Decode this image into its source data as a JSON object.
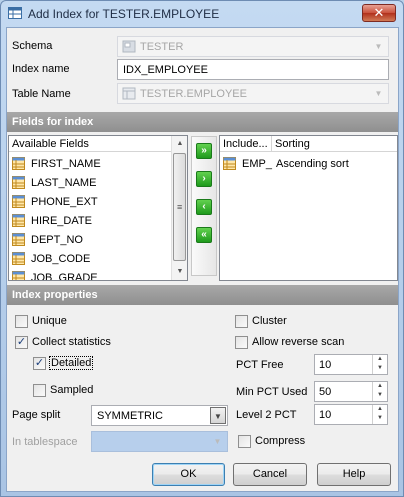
{
  "window": {
    "title": "Add Index for TESTER.EMPLOYEE",
    "close_label": "✕"
  },
  "top": {
    "schema_label": "Schema",
    "schema_value": "TESTER",
    "index_name_label": "Index name",
    "index_name_value": "IDX_EMPLOYEE",
    "table_name_label": "Table Name",
    "table_name_value": "TESTER.EMPLOYEE"
  },
  "fields_section": {
    "title": "Fields for index",
    "available_header": "Available Fields",
    "available": [
      "FIRST_NAME",
      "LAST_NAME",
      "PHONE_EXT",
      "HIRE_DATE",
      "DEPT_NO",
      "JOB_CODE",
      "JOB_GRADE"
    ],
    "included_header": "Include...",
    "sorting_header": "Sorting",
    "included": [
      {
        "name": "EMP_",
        "sorting": "Ascending sort"
      }
    ],
    "buttons": [
      "»",
      "›",
      "‹",
      "«"
    ]
  },
  "props_section": {
    "title": "Index properties",
    "unique": "Unique",
    "unique_checked": false,
    "collect_stats": "Collect statistics",
    "collect_stats_checked": true,
    "detailed": "Detailed",
    "detailed_checked": true,
    "sampled": "Sampled",
    "sampled_checked": false,
    "page_split_label": "Page split",
    "page_split_value": "SYMMETRIC",
    "in_tablespace_label": "In tablespace",
    "in_tablespace_value": "",
    "cluster": "Cluster",
    "cluster_checked": false,
    "allow_reverse": "Allow reverse scan",
    "allow_reverse_checked": false,
    "pct_free_label": "PCT Free",
    "pct_free_value": "10",
    "min_pct_used_label": "Min PCT Used",
    "min_pct_used_value": "50",
    "level2_pct_label": "Level 2 PCT",
    "level2_pct_value": "10",
    "compress": "Compress",
    "compress_checked": false
  },
  "footer": {
    "ok": "OK",
    "cancel": "Cancel",
    "help": "Help"
  },
  "colors": {
    "section_bg": "#999999",
    "green_button": "#2fae2a",
    "title_bg": "#b9d1ea"
  }
}
